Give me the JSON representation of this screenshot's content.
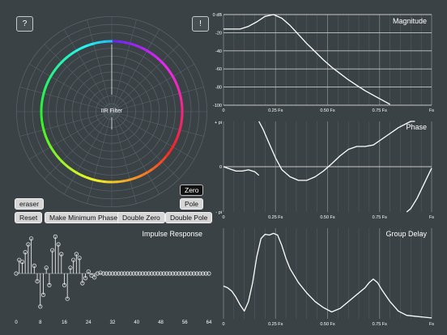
{
  "app": {
    "help_label": "?",
    "info_label": "!",
    "zplane_label": "IIR Filter",
    "colors": {
      "background": "#3a4245",
      "grid": "#56606a",
      "line": "#ffffff",
      "ring_start": "#e53935"
    }
  },
  "controls": {
    "eraser": "eraser",
    "zero": "Zero",
    "pole": "Pole",
    "reset": "Reset",
    "min_phase": "Make Minimum Phase",
    "double_zero": "Double Zero",
    "double_pole": "Double Pole"
  },
  "impulse": {
    "title": "Impulse Response",
    "x_ticks": [
      "0",
      "8",
      "16",
      "24",
      "32",
      "40",
      "48",
      "56",
      "64"
    ]
  },
  "x_axis_ticks": [
    "0",
    "0.25 Fs",
    "0.50 Fs",
    "0.75 Fs",
    "Fs"
  ],
  "chart_data": [
    {
      "type": "line",
      "title": "Magnitude",
      "ylim": [
        -100,
        0
      ],
      "y_ticks": [
        "0 dB",
        "-20",
        "-40",
        "-60",
        "-80",
        "-100"
      ],
      "x": [
        0,
        0.04,
        0.08,
        0.12,
        0.16,
        0.2,
        0.24,
        0.28,
        0.32,
        0.36,
        0.4,
        0.44,
        0.48,
        0.52,
        0.56,
        0.6,
        0.64,
        0.68,
        0.72,
        0.76,
        0.8
      ],
      "values": [
        -16,
        -16,
        -16,
        -13,
        -8,
        -2,
        0,
        -4,
        -12,
        -22,
        -32,
        -41,
        -50,
        -58,
        -65,
        -72,
        -78,
        -84,
        -89,
        -94,
        -99
      ]
    },
    {
      "type": "line",
      "title": "Phase",
      "y_ticks": [
        "+ pi",
        "0",
        "- pi"
      ],
      "ylim": [
        -3.14,
        3.14
      ],
      "segments": [
        {
          "x": [
            0,
            0.03,
            0.06,
            0.09,
            0.12,
            0.15,
            0.17
          ],
          "values": [
            0,
            -0.15,
            -0.3,
            -0.3,
            -0.22,
            -0.35,
            -0.6
          ]
        },
        {
          "x": [
            0.17,
            0.19,
            0.22,
            0.25,
            0.28,
            0.32,
            0.36,
            0.4,
            0.44,
            0.48,
            0.52,
            0.56,
            0.6,
            0.64,
            0.68,
            0.72,
            0.76,
            0.8,
            0.84,
            0.88,
            0.9,
            0.92
          ],
          "values": [
            3.14,
            2.6,
            1.6,
            0.6,
            -0.2,
            -0.7,
            -0.95,
            -0.95,
            -0.7,
            -0.3,
            0.2,
            0.75,
            1.2,
            1.4,
            1.4,
            1.5,
            1.9,
            2.3,
            2.7,
            3.0,
            3.14,
            3.14
          ]
        },
        {
          "x": [
            0.88,
            0.9,
            0.93,
            0.96,
            1.0
          ],
          "values": [
            -3.14,
            -2.9,
            -2.2,
            -1.3,
            -0.1
          ]
        }
      ]
    },
    {
      "type": "line",
      "title": "Group Delay",
      "x": [
        0,
        0.02,
        0.04,
        0.06,
        0.08,
        0.1,
        0.12,
        0.14,
        0.16,
        0.18,
        0.2,
        0.22,
        0.24,
        0.26,
        0.28,
        0.3,
        0.32,
        0.36,
        0.4,
        0.44,
        0.48,
        0.52,
        0.56,
        0.6,
        0.64,
        0.68,
        0.7,
        0.72,
        0.74,
        0.76,
        0.8,
        0.84,
        0.88,
        0.92,
        0.96,
        1.0
      ],
      "values": [
        0.38,
        0.36,
        0.32,
        0.25,
        0.16,
        0.09,
        0.2,
        0.42,
        0.72,
        0.93,
        0.98,
        0.97,
        0.99,
        0.97,
        0.85,
        0.7,
        0.58,
        0.42,
        0.3,
        0.2,
        0.13,
        0.08,
        0.12,
        0.2,
        0.28,
        0.36,
        0.42,
        0.46,
        0.42,
        0.34,
        0.2,
        0.09,
        0.04,
        0.03,
        0.02,
        0.01
      ]
    }
  ]
}
